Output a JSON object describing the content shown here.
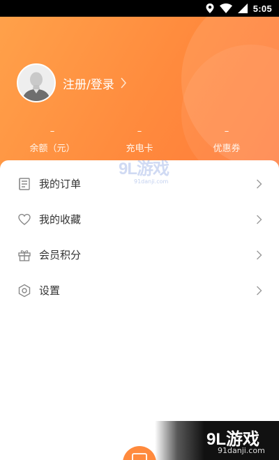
{
  "status_bar": {
    "time": "5:05",
    "icons": [
      "location-icon",
      "wifi-icon",
      "signal-icon"
    ]
  },
  "profile": {
    "login_label": "注册/登录"
  },
  "stats": [
    {
      "value": "–",
      "label": "余额（元）"
    },
    {
      "value": "–",
      "label": "充电卡"
    },
    {
      "value": "–",
      "label": "优惠券"
    }
  ],
  "menu": [
    {
      "label": "我的订单",
      "icon": "orders-icon"
    },
    {
      "label": "我的收藏",
      "icon": "heart-icon"
    },
    {
      "label": "会员积分",
      "icon": "gift-icon"
    },
    {
      "label": "设置",
      "icon": "settings-icon"
    }
  ],
  "watermark": {
    "brand": "9L游戏",
    "site": "91danji.com"
  },
  "colors": {
    "header_start": "#ffa14a",
    "header_end": "#ff7a3b",
    "accent": "#ff8a3d",
    "text": "#333333",
    "icon": "#888888"
  }
}
